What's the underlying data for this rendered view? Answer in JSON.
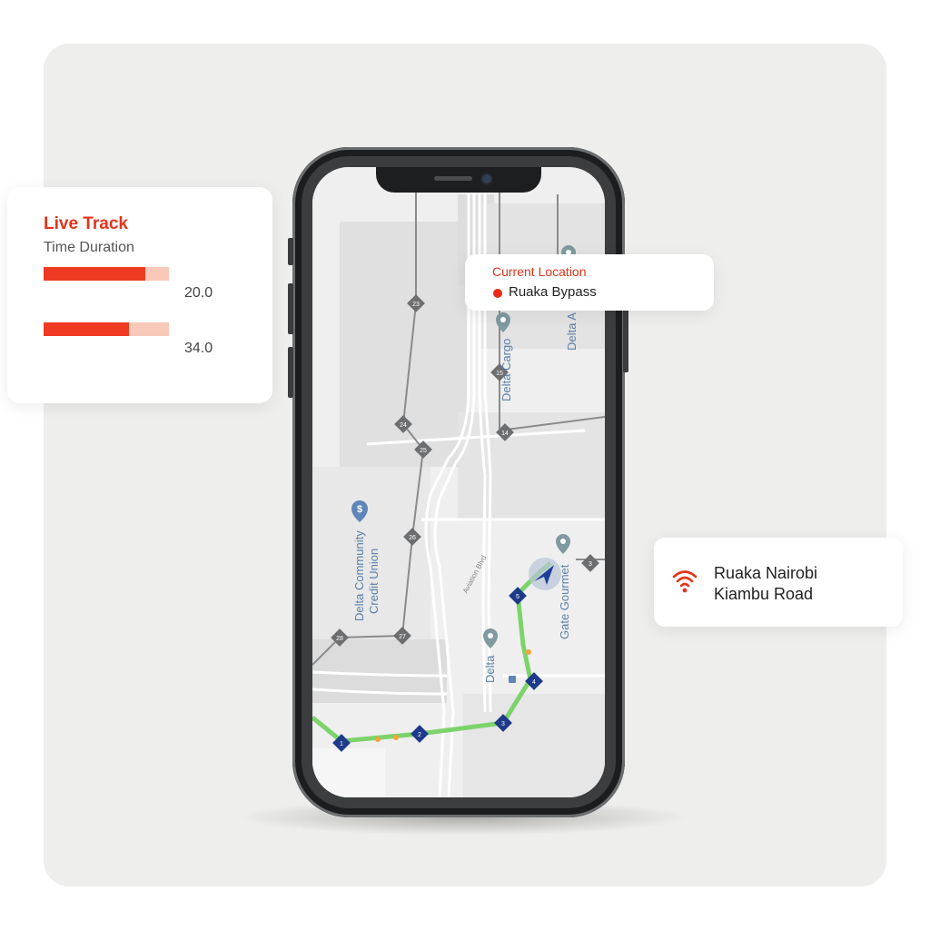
{
  "live_track": {
    "title": "Live Track",
    "subtitle": "Time Duration",
    "bars": [
      {
        "value_label": "20.0",
        "fill_fraction": 0.81
      },
      {
        "value_label": "34.0",
        "fill_fraction": 0.68
      }
    ]
  },
  "current_location": {
    "title": "Current Location",
    "place": "Ruaka Bypass"
  },
  "road": {
    "line1": "Ruaka Nairobi",
    "line2": "Kiambu Road"
  },
  "map": {
    "labels": {
      "credit_union": [
        "Delta Community",
        "Credit Union"
      ],
      "cargo": "Delta Cargo",
      "gate": "Gate Gourmet",
      "delta": "Delta",
      "delta_a": "Delta A",
      "road": "Aviation Blvd"
    },
    "grey_markers": [
      "23",
      "24",
      "25",
      "26",
      "27",
      "28",
      "15",
      "14",
      "3"
    ],
    "route_stops": [
      "1",
      "2",
      "3",
      "4",
      "5"
    ]
  },
  "colors": {
    "accent": "#e2341c",
    "route": "#7dd36b",
    "marker_blue": "#1e3a8a",
    "marker_grey": "#6d6e70"
  },
  "icons": [
    "signal-icon",
    "navigation-arrow-icon",
    "pin-icon",
    "dollar-icon"
  ]
}
